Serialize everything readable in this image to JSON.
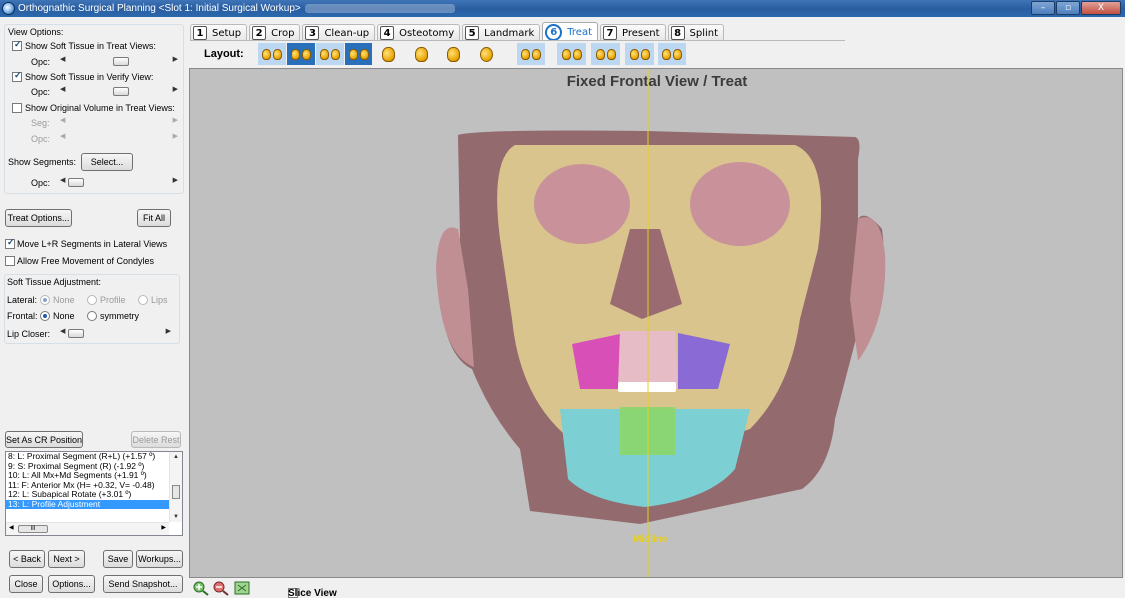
{
  "window": {
    "title": "Orthognathic Surgical Planning <Slot 1: Initial Surgical Workup>",
    "buttons": {
      "minimize": "–",
      "maximize": "▫",
      "close": "X"
    }
  },
  "view_options": {
    "header": "View Options:",
    "soft_tissue_treat": {
      "label": "Show Soft Tissue in Treat Views:",
      "checked": true,
      "opc_label": "Opc:"
    },
    "soft_tissue_verify": {
      "label": "Show Soft Tissue in Verify View:",
      "checked": true,
      "opc_label": "Opc:"
    },
    "original_volume": {
      "label": "Show Original Volume in Treat Views:",
      "checked": false,
      "seg_label": "Seg:",
      "opc_label": "Opc:"
    },
    "show_segments_label": "Show Segments:",
    "select_button": "Select...",
    "segments_opc_label": "Opc:"
  },
  "treat_options_button": "Treat Options...",
  "fit_all_button": "Fit All",
  "move_lr_segments": {
    "label": "Move L+R Segments in Lateral Views",
    "checked": true
  },
  "allow_free_condyles": {
    "label": "Allow Free Movement of Condyles",
    "checked": false
  },
  "soft_tissue_adjustment": {
    "header": "Soft Tissue Adjustment:",
    "lateral_label": "Lateral:",
    "lateral_options": [
      "None",
      "Profile",
      "Lips"
    ],
    "lateral_selected": "None",
    "frontal_label": "Frontal:",
    "frontal_options": [
      "None",
      "symmetry"
    ],
    "frontal_selected": "None",
    "lip_closer_label": "Lip Closer:"
  },
  "set_cr_button": "Set As CR Position",
  "delete_rest_button": "Delete Rest",
  "history": [
    "8: L: Proximal Segment (R+L) (+1.57 º)",
    "9: S: Proximal Segment (R) (-1.92 º)",
    "10: L: All Mx+Md Segments (+1.91 º)",
    "11: F: Anterior Mx (H= +0.32, V= -0.48)",
    "12: L: Subapical Rotate (+3.01 º)",
    "13: L: Profile Adjustment"
  ],
  "history_selected_index": 5,
  "hscroll_thumb": "III",
  "nav_buttons": {
    "back": "< Back",
    "next": "Next >",
    "save": "Save",
    "workups": "Workups..."
  },
  "footer_buttons": {
    "close": "Close",
    "options": "Options...",
    "snapshot": "Send Snapshot..."
  },
  "tabs": [
    {
      "num": "1",
      "label": "Setup"
    },
    {
      "num": "2",
      "label": "Crop"
    },
    {
      "num": "3",
      "label": "Clean-up"
    },
    {
      "num": "4",
      "label": "Osteotomy"
    },
    {
      "num": "5",
      "label": "Landmark"
    },
    {
      "num": "6",
      "label": "Treat",
      "active": true
    },
    {
      "num": "7",
      "label": "Present"
    },
    {
      "num": "8",
      "label": "Splint"
    }
  ],
  "layout_label": "Layout:",
  "view": {
    "title": "Fixed Frontal View / Treat",
    "midline_label": "Midline"
  },
  "slice_view": {
    "label": "Slice View",
    "checked": false
  },
  "colors": {
    "accent": "#1a72c7",
    "viewport_bg": "#c0c0c0",
    "midline": "#e6d020",
    "skin": "#8b5b5e",
    "bone": "#d9c48e",
    "segment_pink": "#d84fb8",
    "segment_purple": "#8a6ad4",
    "segment_cyan": "#7ccfd2",
    "segment_green": "#8cd66a",
    "selection": "#3399ff"
  }
}
